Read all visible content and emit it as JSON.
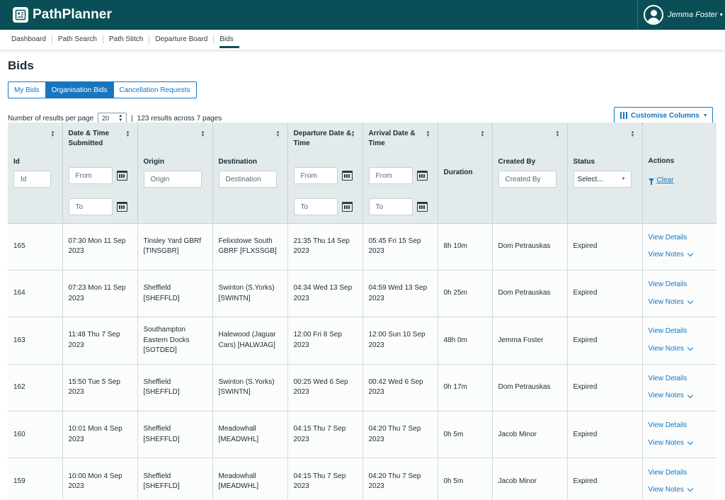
{
  "app": {
    "title": "PathPlanner"
  },
  "user": {
    "name": "Jemma Foster"
  },
  "nav": [
    "Dashboard",
    "Path Search",
    "Path Stitch",
    "Departure Board",
    "Bids"
  ],
  "page": {
    "title": "Bids"
  },
  "tabs": [
    "My Bids",
    "Organisation Bids",
    "Cancellation Requests"
  ],
  "results": {
    "per_page_label": "Number of results per page",
    "per_page_value": "20",
    "summary": "123 results across 7 pages"
  },
  "customise_label": "Customise Columns",
  "columns": {
    "id": "Id",
    "submitted": "Date & Time Submitted",
    "origin": "Origin",
    "destination": "Destination",
    "departure": "Departure Date & Time",
    "arrival": "Arrival Date & Time",
    "duration": "Duration",
    "created_by": "Created By",
    "status": "Status",
    "actions": "Actions"
  },
  "filters": {
    "id": "Id",
    "from": "From",
    "to": "To",
    "origin": "Origin",
    "destination": "Destination",
    "created_by": "Created By",
    "status": "Select...",
    "clear": "Clear"
  },
  "actions": {
    "details": "View Details",
    "notes": "View Notes"
  },
  "rows": [
    {
      "id": "165",
      "submitted": [
        "07:30 Mon 11 Sep",
        "2023"
      ],
      "origin": [
        "Tinsley Yard GBRf",
        "[TINSGBR]"
      ],
      "destination": [
        "Felixstowe South",
        "GBRF [FLXSSGB]"
      ],
      "departure": [
        "21:35 Thu 14 Sep",
        "2023"
      ],
      "arrival": [
        "05:45 Fri 15 Sep",
        "2023"
      ],
      "duration": "8h 10m",
      "created_by": "Dom Petrauskas",
      "status": "Expired"
    },
    {
      "id": "164",
      "submitted": [
        "07:23 Mon 11 Sep",
        "2023"
      ],
      "origin": [
        "Sheffield",
        "[SHEFFLD]"
      ],
      "destination": [
        "Swinton (S.Yorks)",
        "[SWINTN]"
      ],
      "departure": [
        "04:34 Wed 13 Sep",
        "2023"
      ],
      "arrival": [
        "04:59 Wed 13 Sep",
        "2023"
      ],
      "duration": "0h 25m",
      "created_by": "Dom Petrauskas",
      "status": "Expired"
    },
    {
      "id": "163",
      "submitted": [
        "11:48 Thu 7 Sep",
        "2023"
      ],
      "origin": [
        "Southampton",
        "Eastern Docks",
        "[SOTDED]"
      ],
      "destination": [
        "Halewood (Jaguar",
        "Cars) [HALWJAG]"
      ],
      "departure": [
        "12:00 Fri 8 Sep",
        "2023"
      ],
      "arrival": [
        "12:00 Sun 10 Sep",
        "2023"
      ],
      "duration": "48h 0m",
      "created_by": "Jemma Foster",
      "status": "Expired"
    },
    {
      "id": "162",
      "submitted": [
        "15:50 Tue 5 Sep",
        "2023"
      ],
      "origin": [
        "Sheffield",
        "[SHEFFLD]"
      ],
      "destination": [
        "Swinton (S.Yorks)",
        "[SWINTN]"
      ],
      "departure": [
        "00:25 Wed 6 Sep",
        "2023"
      ],
      "arrival": [
        "00:42 Wed 6 Sep",
        "2023"
      ],
      "duration": "0h 17m",
      "created_by": "Dom Petrauskas",
      "status": "Expired"
    },
    {
      "id": "160",
      "submitted": [
        "10:01 Mon 4 Sep",
        "2023"
      ],
      "origin": [
        "Sheffield",
        "[SHEFFLD]"
      ],
      "destination": [
        "Meadowhall",
        "[MEADWHL]"
      ],
      "departure": [
        "04:15 Thu 7 Sep",
        "2023"
      ],
      "arrival": [
        "04:20 Thu 7 Sep",
        "2023"
      ],
      "duration": "0h 5m",
      "created_by": "Jacob Minor",
      "status": "Expired"
    },
    {
      "id": "159",
      "submitted": [
        "10:00 Mon 4 Sep",
        "2023"
      ],
      "origin": [
        "Sheffield",
        "[SHEFFLD]"
      ],
      "destination": [
        "Meadowhall",
        "[MEADWHL]"
      ],
      "departure": [
        "04:15 Thu 7 Sep",
        "2023"
      ],
      "arrival": [
        "04:20 Thu 7 Sep",
        "2023"
      ],
      "duration": "0h 5m",
      "created_by": "Jacob Minor",
      "status": "Expired"
    }
  ]
}
